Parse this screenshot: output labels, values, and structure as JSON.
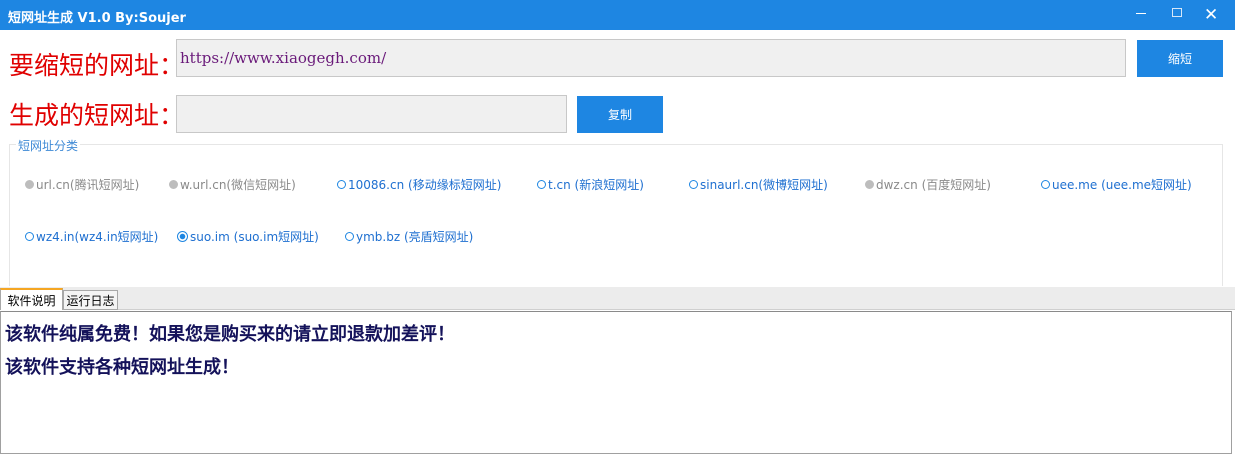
{
  "window": {
    "title": "短网址生成    V1.0 By:Soujer"
  },
  "form": {
    "url_label": "要缩短的网址：",
    "url_value": "https://www.xiaogegh.com/",
    "shorten_button": "缩短",
    "result_label": "生成的短网址：",
    "result_value": "",
    "copy_button": "复制"
  },
  "category": {
    "legend": "短网址分类",
    "options": [
      {
        "label": "url.cn(腾讯短网址)",
        "state": "disabled"
      },
      {
        "label": "w.url.cn(微信短网址)",
        "state": "disabled"
      },
      {
        "label": "10086.cn (移动缘标短网址)",
        "state": "enabled"
      },
      {
        "label": "t.cn (新浪短网址)",
        "state": "enabled"
      },
      {
        "label": "sinaurl.cn(微博短网址)",
        "state": "enabled"
      },
      {
        "label": "dwz.cn (百度短网址)",
        "state": "disabled"
      },
      {
        "label": "uee.me (uee.me短网址)",
        "state": "enabled"
      },
      {
        "label": "wz4.in(wz4.in短网址)",
        "state": "enabled"
      },
      {
        "label": "suo.im (suo.im短网址)",
        "state": "checked"
      },
      {
        "label": "ymb.bz (亮盾短网址)",
        "state": "enabled"
      }
    ]
  },
  "tabs": [
    {
      "label": "软件说明",
      "active": true
    },
    {
      "label": "运行日志",
      "active": false
    }
  ],
  "content": {
    "lines": [
      "该软件纯属免费！如果您是购买来的请立即退款加差评！",
      "该软件支持各种短网址生成！"
    ]
  },
  "colors": {
    "accent": "#1e86e2",
    "label_red": "#e00000",
    "content_text": "#14125a"
  }
}
